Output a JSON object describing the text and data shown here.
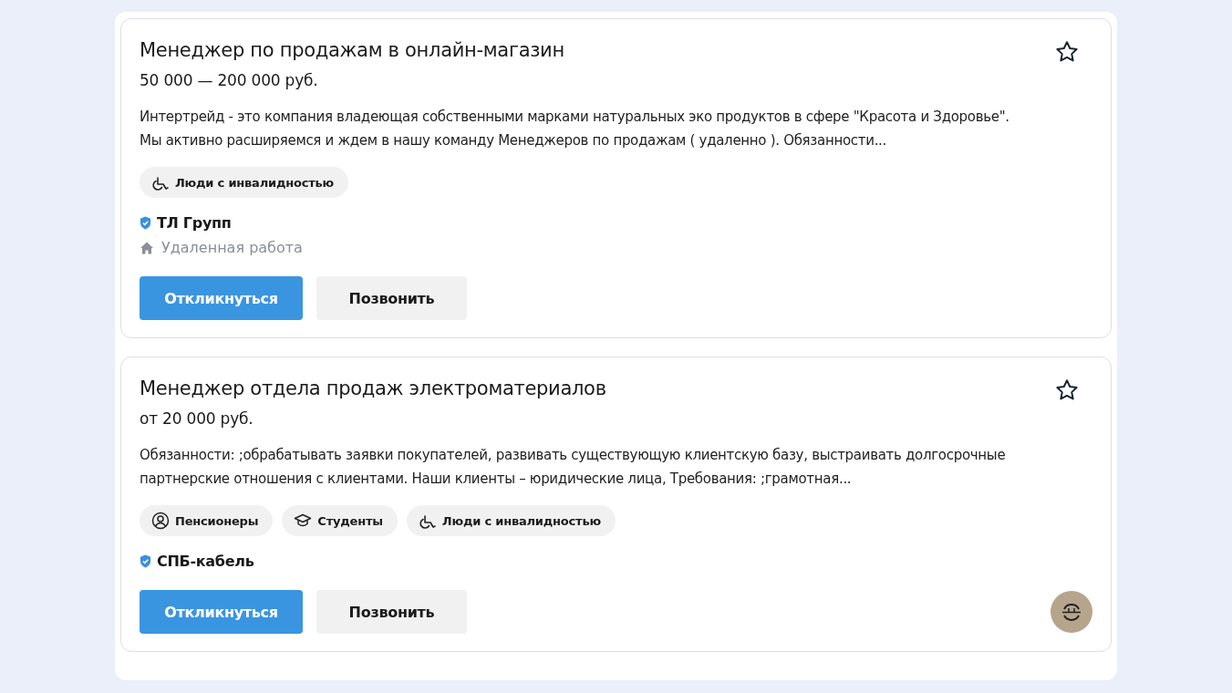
{
  "vacancies": [
    {
      "title": "Менеджер по продажам в онлайн-магазин",
      "salary": "50 000 — 200 000 руб.",
      "favorite": false,
      "description": "Интертрейд - это компания владеющая собственными марками натуральных эко продуктов в сфере \"Красота и Здоровье\". Мы активно расширяемся и ждем в нашу команду Менеджеров по продажам ( удаленно ). Обязанности...",
      "tags": [
        {
          "kind": "disability",
          "label": "Люди с инвалидностью"
        }
      ],
      "company": "ТЛ Групп",
      "verified": true,
      "location": "Удаленная работа",
      "logo": false,
      "buttons": {
        "respond": "Откликнуться",
        "call": "Позвонить"
      }
    },
    {
      "title": "Менеджер отдела продаж электроматериалов",
      "salary": "от 20 000 руб.",
      "favorite": false,
      "description": "Обязанности: ;обрабатывать заявки покупателей, развивать существующую клиентскую базу, выстраивать долгосрочные партнерские отношения с клиентами. Наши клиенты – юридические лица, Требования: ;грамотная...",
      "tags": [
        {
          "kind": "pensioner",
          "label": "Пенсионеры"
        },
        {
          "kind": "student",
          "label": "Студенты"
        },
        {
          "kind": "disability",
          "label": "Люди с инвалидностью"
        }
      ],
      "company": "СПБ-кабель",
      "verified": true,
      "logo": true,
      "buttons": {
        "respond": "Откликнуться",
        "call": "Позвонить"
      }
    }
  ]
}
